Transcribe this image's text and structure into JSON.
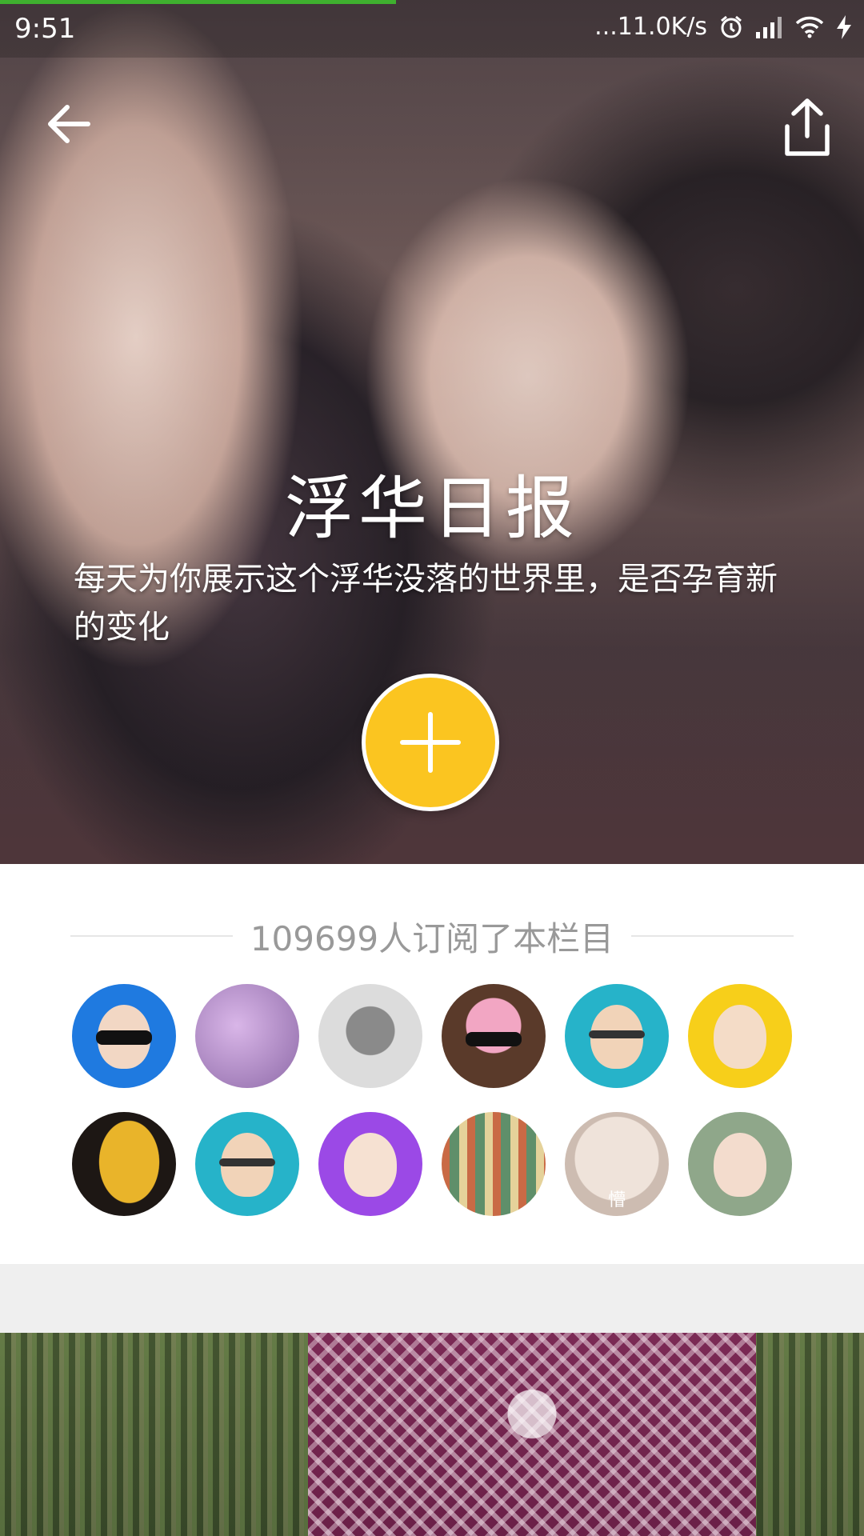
{
  "status_bar": {
    "time": "9:51",
    "network_speed": "...11.0K/s",
    "icons": [
      "alarm-icon",
      "signal-icon",
      "wifi-icon",
      "charging-icon"
    ],
    "load_progress": 0.46
  },
  "header": {
    "back_icon": "arrow-left-icon",
    "share_icon": "share-icon"
  },
  "hero": {
    "title": "浮华日报",
    "description": "每天为你展示这个浮华没落的世界里，是否孕育新的变化",
    "subscribe_icon": "plus-icon",
    "accent_color": "#fbc520"
  },
  "subscribers": {
    "count_text": "109699人订阅了本栏目",
    "avatars": [
      {
        "name": "avatar-old-man-sunglasses"
      },
      {
        "name": "avatar-purple-photo"
      },
      {
        "name": "avatar-gray-cat"
      },
      {
        "name": "avatar-pig-mask"
      },
      {
        "name": "avatar-round-glasses-man"
      },
      {
        "name": "avatar-einstein"
      },
      {
        "name": "avatar-mango"
      },
      {
        "name": "avatar-round-glasses-man-2"
      },
      {
        "name": "avatar-chaplin"
      },
      {
        "name": "avatar-street-scene"
      },
      {
        "name": "avatar-cat-blush",
        "label": "懵"
      },
      {
        "name": "avatar-girl-cartoon"
      }
    ]
  }
}
